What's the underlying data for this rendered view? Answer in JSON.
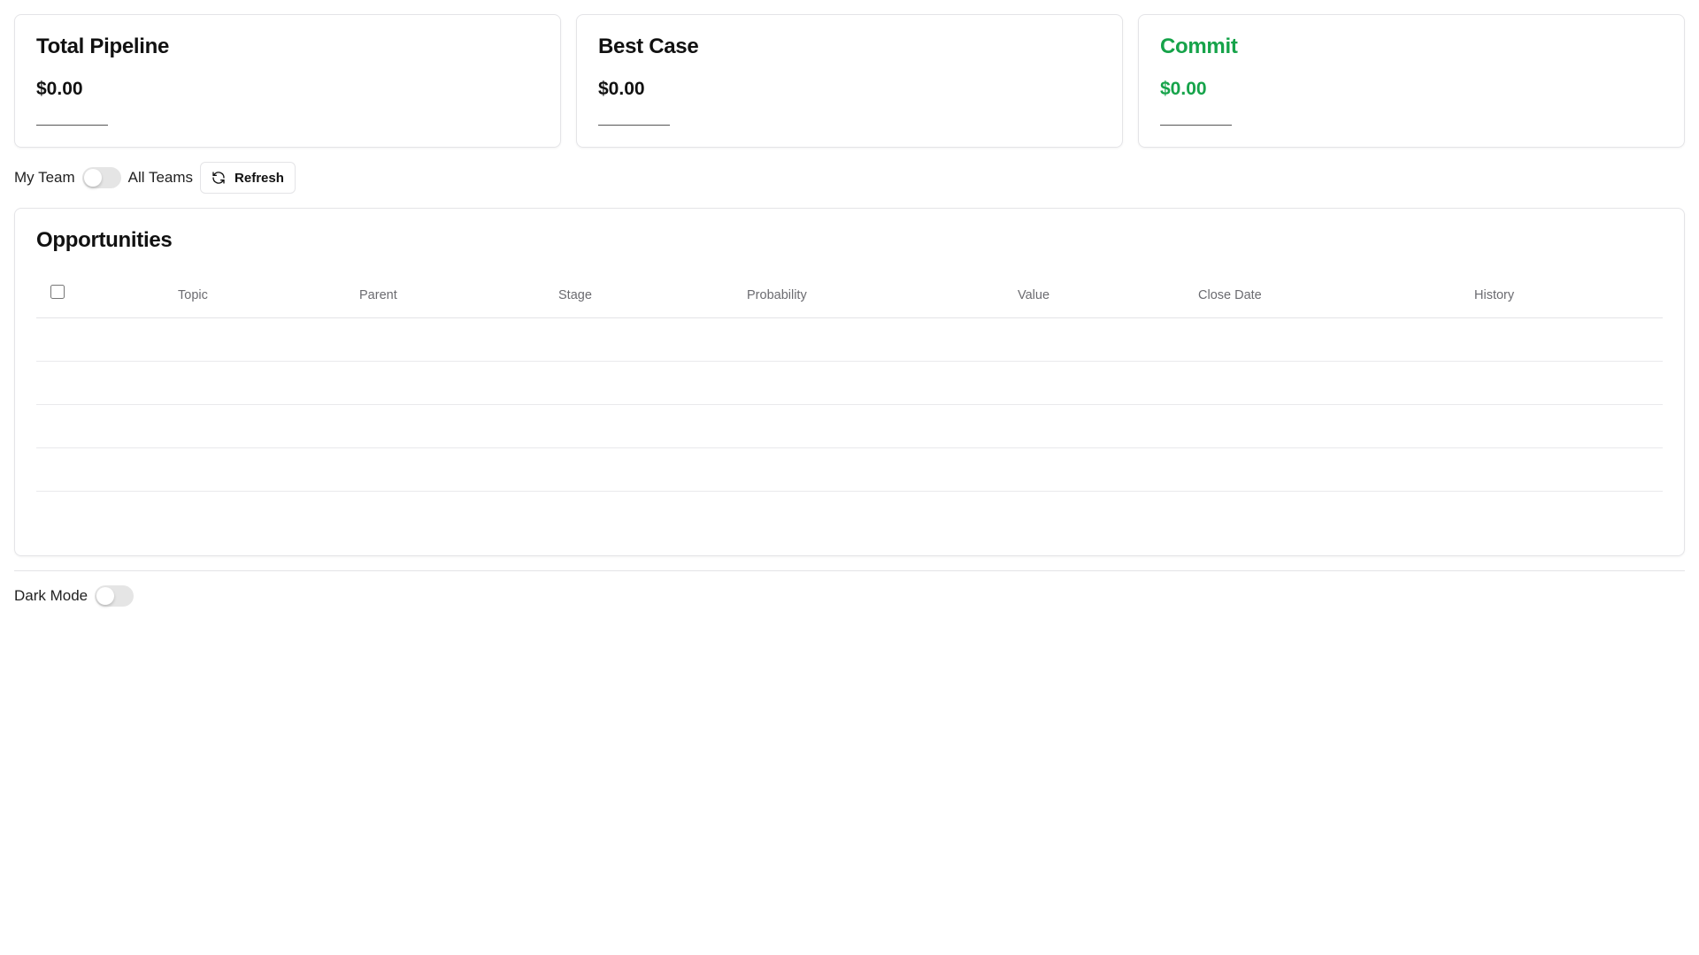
{
  "cards": [
    {
      "title": "Total Pipeline",
      "value": "$0.00"
    },
    {
      "title": "Best Case",
      "value": "$0.00"
    },
    {
      "title": "Commit",
      "value": "$0.00"
    }
  ],
  "accent_green": "#16a34a",
  "team_toggle": {
    "left_label": "My Team",
    "right_label": "All Teams",
    "checked": false
  },
  "refresh": {
    "label": "Refresh",
    "icon": "refresh-icon"
  },
  "opportunities": {
    "title": "Opportunities",
    "columns": [
      "Topic",
      "Parent",
      "Stage",
      "Probability",
      "Value",
      "Close Date",
      "History"
    ]
  },
  "dark_mode": {
    "label": "Dark Mode",
    "checked": false
  }
}
